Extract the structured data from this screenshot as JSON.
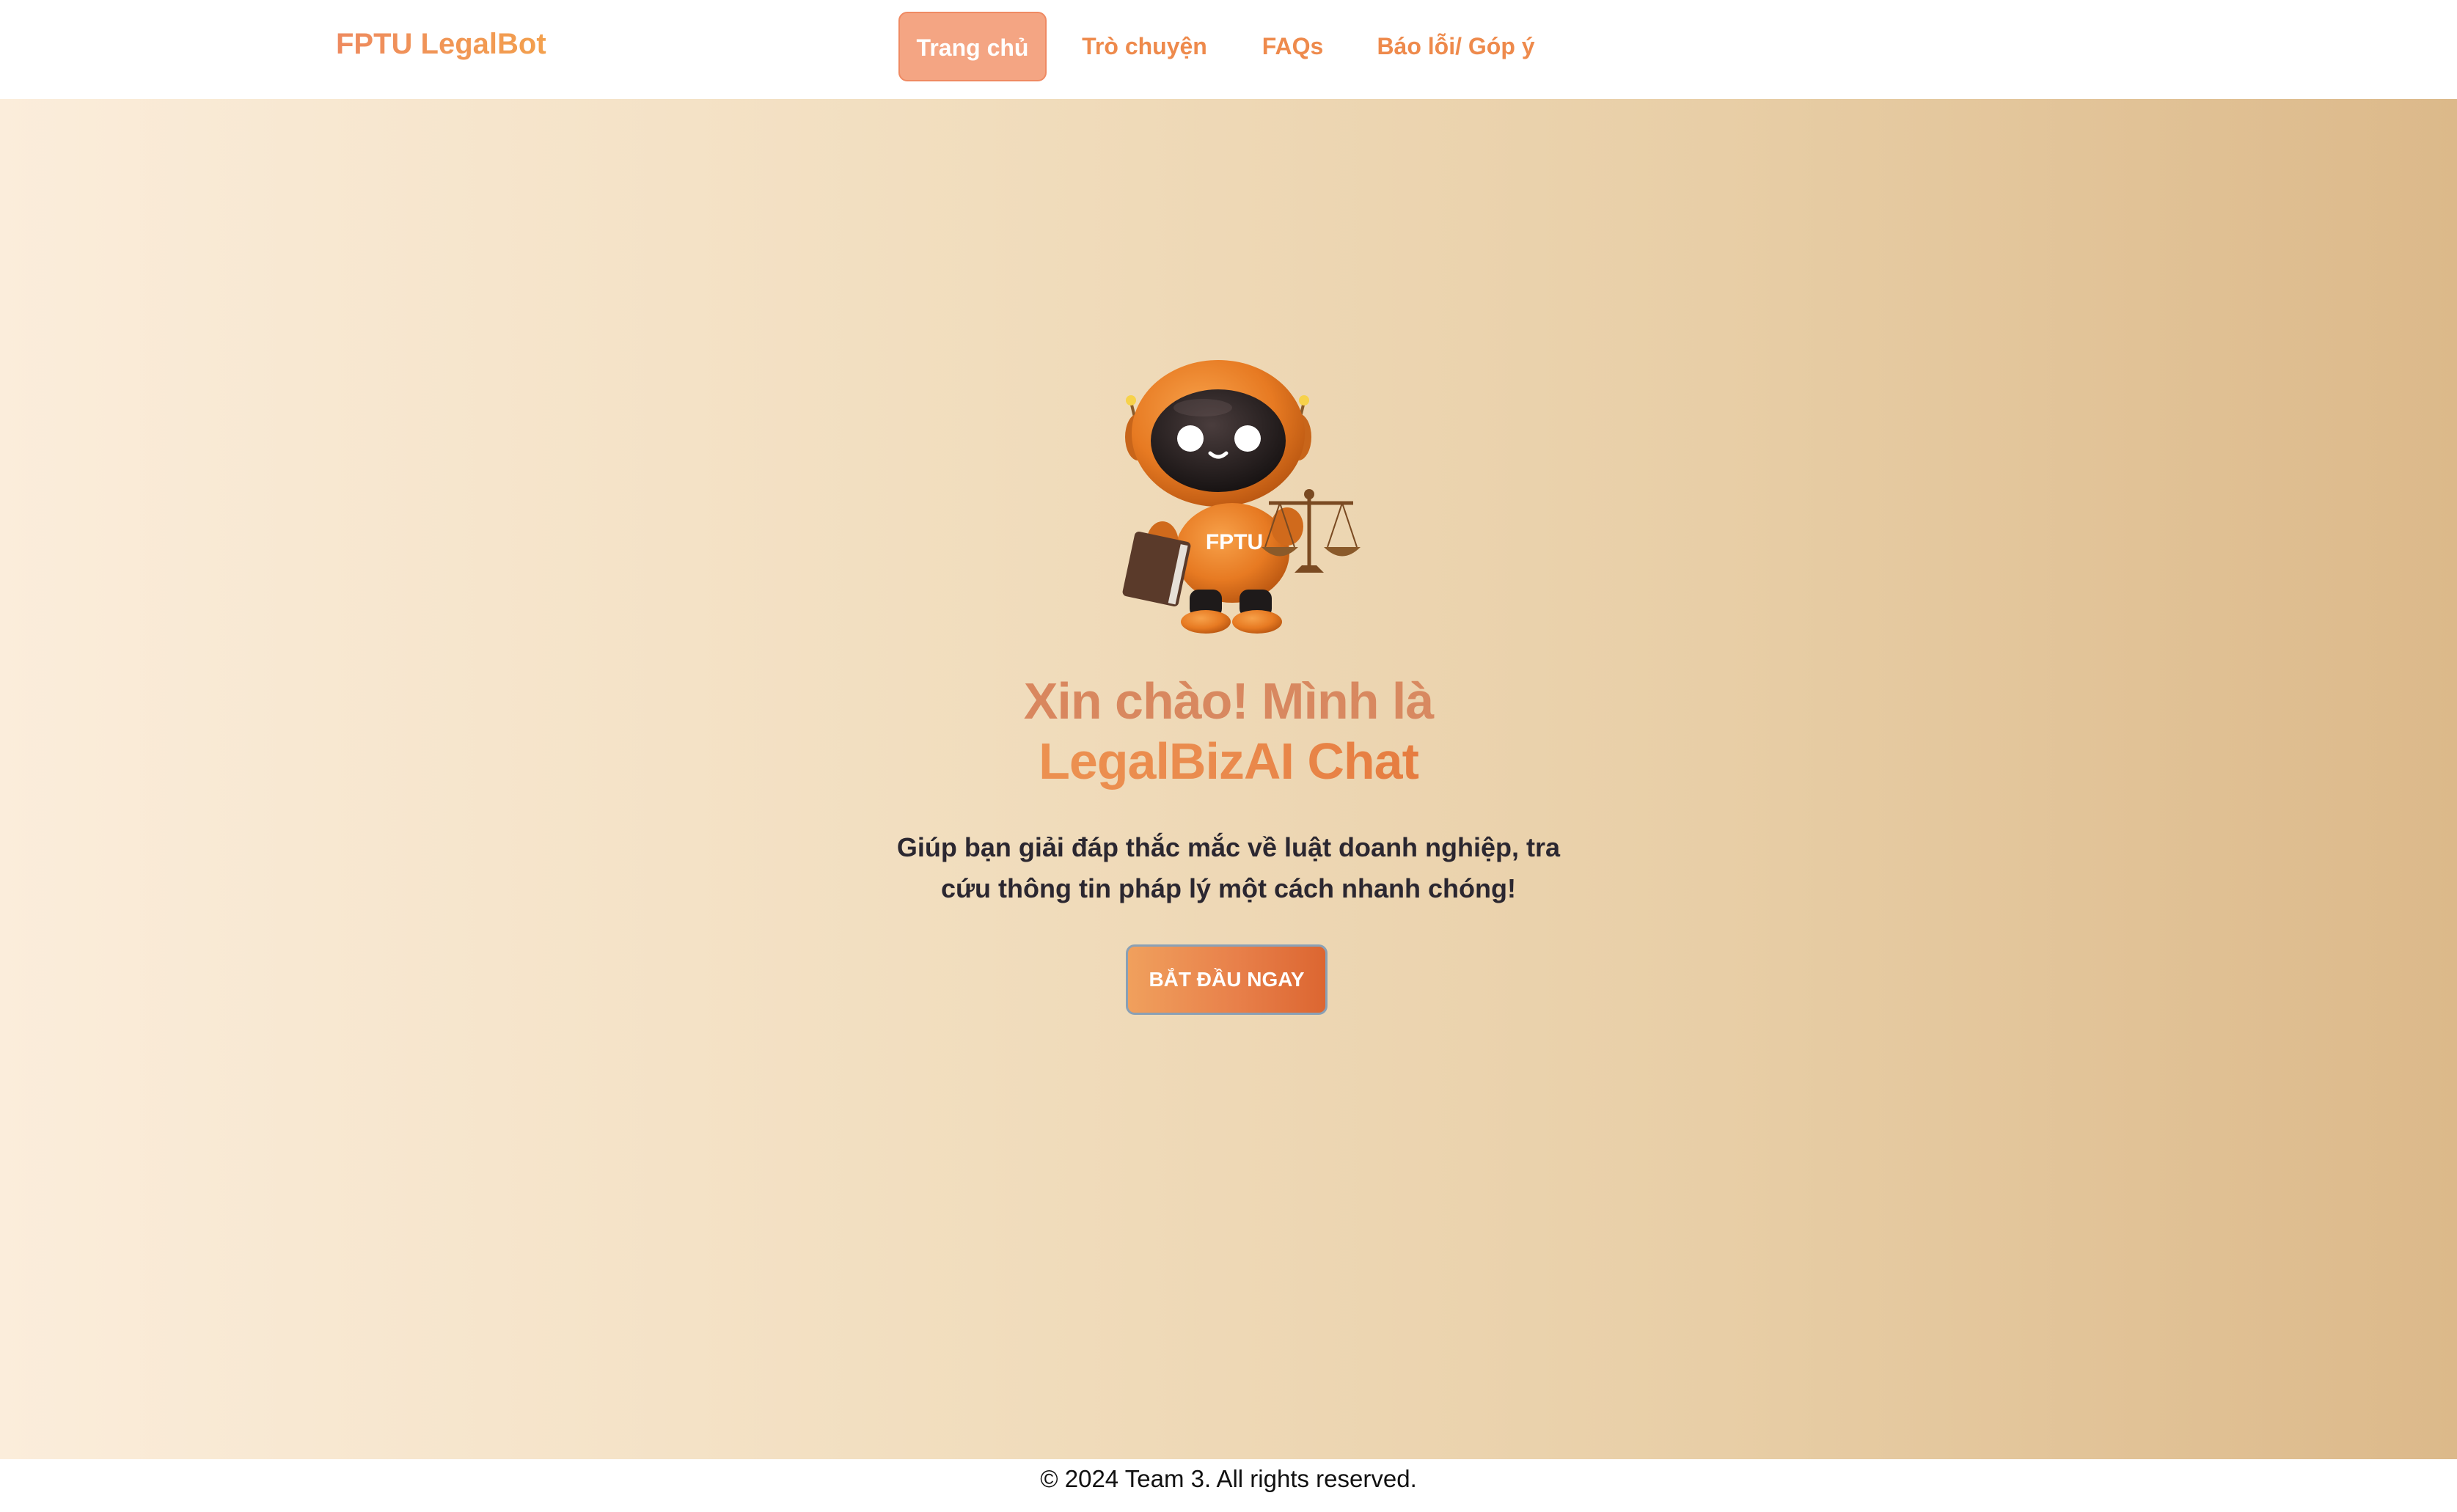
{
  "header": {
    "brand": "FPTU LegalBot",
    "nav": [
      {
        "label": "Trang chủ",
        "active": true
      },
      {
        "label": "Trò chuyện",
        "active": false
      },
      {
        "label": "FAQs",
        "active": false
      },
      {
        "label": "Báo lỗi/ Góp ý",
        "active": false
      }
    ]
  },
  "hero": {
    "robot_icon": "legal-robot-icon",
    "robot_chest_text": "FPTU",
    "title_line1": "Xin chào! Mình là",
    "title_line2": "LegalBizAI Chat",
    "tagline": "Giúp bạn giải đáp thắc mắc về luật doanh nghiệp, tra cứu thông tin pháp lý một cách nhanh chóng!",
    "cta_label": "BẮT ĐẦU NGAY"
  },
  "footer": {
    "copyright": "© 2024 Team 3. All rights reserved."
  },
  "colors": {
    "accent": "#ee8a4c",
    "nav_active_bg": "#f4a583",
    "hero_gradient_start": "#fbeddb",
    "hero_gradient_end": "#dcb98a",
    "cta_gradient_start": "#f0a05d",
    "cta_gradient_end": "#dc6631"
  }
}
